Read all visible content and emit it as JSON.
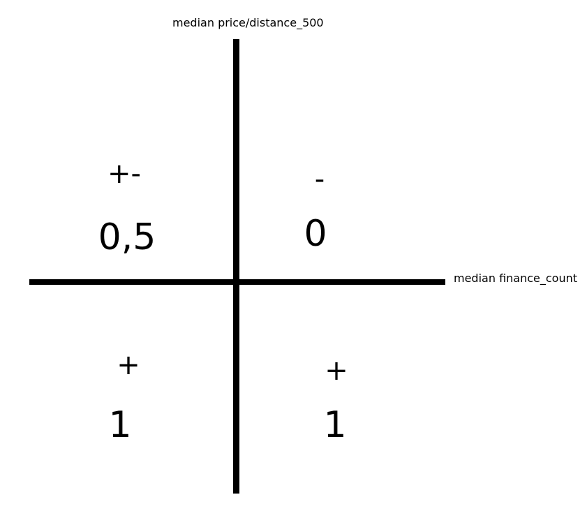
{
  "axes": {
    "y_label": "median price/distance_500",
    "x_label": "median finance_count"
  },
  "quadrants": {
    "top_left": {
      "sign": "+-",
      "value": "0,5"
    },
    "top_right": {
      "sign": "-",
      "value": "0"
    },
    "bottom_left": {
      "sign": "+",
      "value": "1"
    },
    "bottom_right": {
      "sign": "+",
      "value": "1"
    }
  }
}
